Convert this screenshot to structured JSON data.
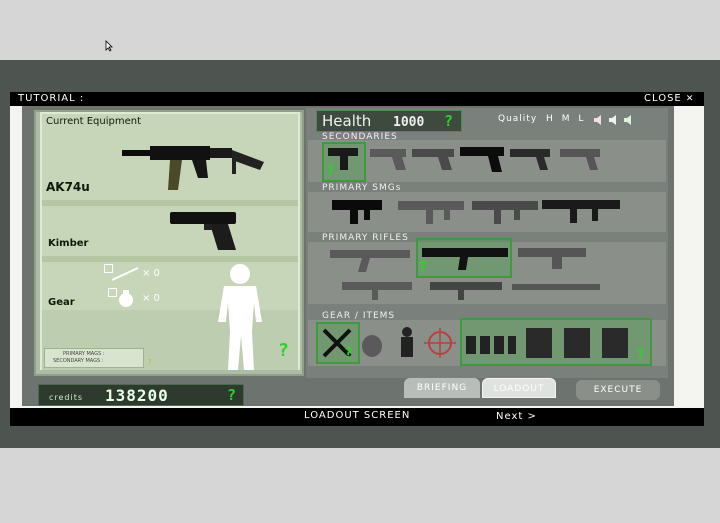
{
  "header": {
    "tutorial": "TUTORIAL :",
    "close": "CLOSE",
    "close_icon": "x-icon"
  },
  "footer": {
    "screen": "LOADOUT SCREEN",
    "next": "Next >"
  },
  "equipment": {
    "title": "Current Equipment",
    "primary": "AK74u",
    "secondary": "Kimber",
    "gear_label": "Gear",
    "gear_count_1": "× 0",
    "gear_count_2": "× 0",
    "mags_primary": "PRIMARY MAGS :",
    "mags_secondary": "SECONDARY MAGS :",
    "mags_q": "?",
    "help_q": "?"
  },
  "credits": {
    "label": "credits",
    "value": "138200",
    "help": "?"
  },
  "health": {
    "label": "Health",
    "value": "1000",
    "help": "?"
  },
  "quality": {
    "label": "Quality",
    "h": "H",
    "m": "M",
    "l": "L"
  },
  "sections": {
    "secondaries": "SECONDARIES",
    "smgs": "PRIMARY SMGs",
    "rifles": "PRIMARY RIFLES",
    "gear": "GEAR / ITEMS"
  },
  "buttons": {
    "briefing": "BRIEFING",
    "loadout": "LOADOUT",
    "execute": "EXECUTE"
  },
  "help_marks": {
    "secondary": "?",
    "rifle": "?",
    "gear_left": "?",
    "gear_right": "?"
  },
  "colors": {
    "highlight": "#3f9a3f",
    "accent_green": "#2bd22b",
    "panel": "#c7d6b8"
  }
}
